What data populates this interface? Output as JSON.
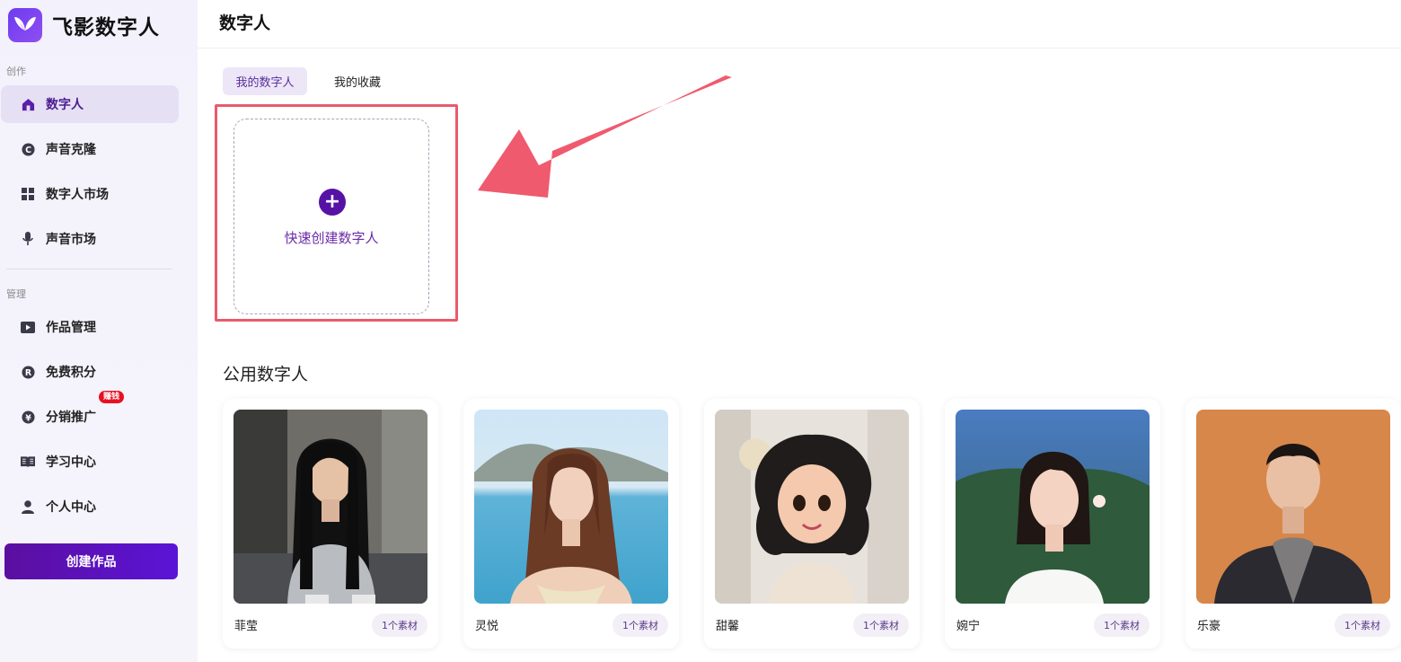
{
  "app": {
    "name": "飞影数字人"
  },
  "sidebar": {
    "section_create": "创作",
    "section_manage": "管理",
    "items": [
      {
        "label": "数字人",
        "icon": "home-icon",
        "active": true
      },
      {
        "label": "声音克隆",
        "icon": "copyright-icon"
      },
      {
        "label": "数字人市场",
        "icon": "grid-icon"
      },
      {
        "label": "声音市场",
        "icon": "microphone-icon"
      },
      {
        "label": "作品管理",
        "icon": "play-icon"
      },
      {
        "label": "免费积分",
        "icon": "registered-icon"
      },
      {
        "label": "分销推广",
        "icon": "yen-icon",
        "badge": "赚钱"
      },
      {
        "label": "学习中心",
        "icon": "book-icon"
      },
      {
        "label": "个人中心",
        "icon": "user-icon"
      }
    ],
    "create_button": "创建作品"
  },
  "header": {
    "title": "数字人"
  },
  "tabs": [
    {
      "label": "我的数字人",
      "active": true
    },
    {
      "label": "我的收藏"
    }
  ],
  "create_card": {
    "label": "快速创建数字人"
  },
  "public_section": {
    "title": "公用数字人",
    "avatars": [
      {
        "name": "菲莹",
        "tag": "1个素材"
      },
      {
        "name": "灵悦",
        "tag": "1个素材"
      },
      {
        "name": "甜馨",
        "tag": "1个素材"
      },
      {
        "name": "婉宁",
        "tag": "1个素材"
      },
      {
        "name": "乐豪",
        "tag": "1个素材"
      }
    ]
  },
  "colors": {
    "accent": "#5612a5",
    "highlight_border": "#ea5a6c",
    "badge": "#e8101f"
  }
}
